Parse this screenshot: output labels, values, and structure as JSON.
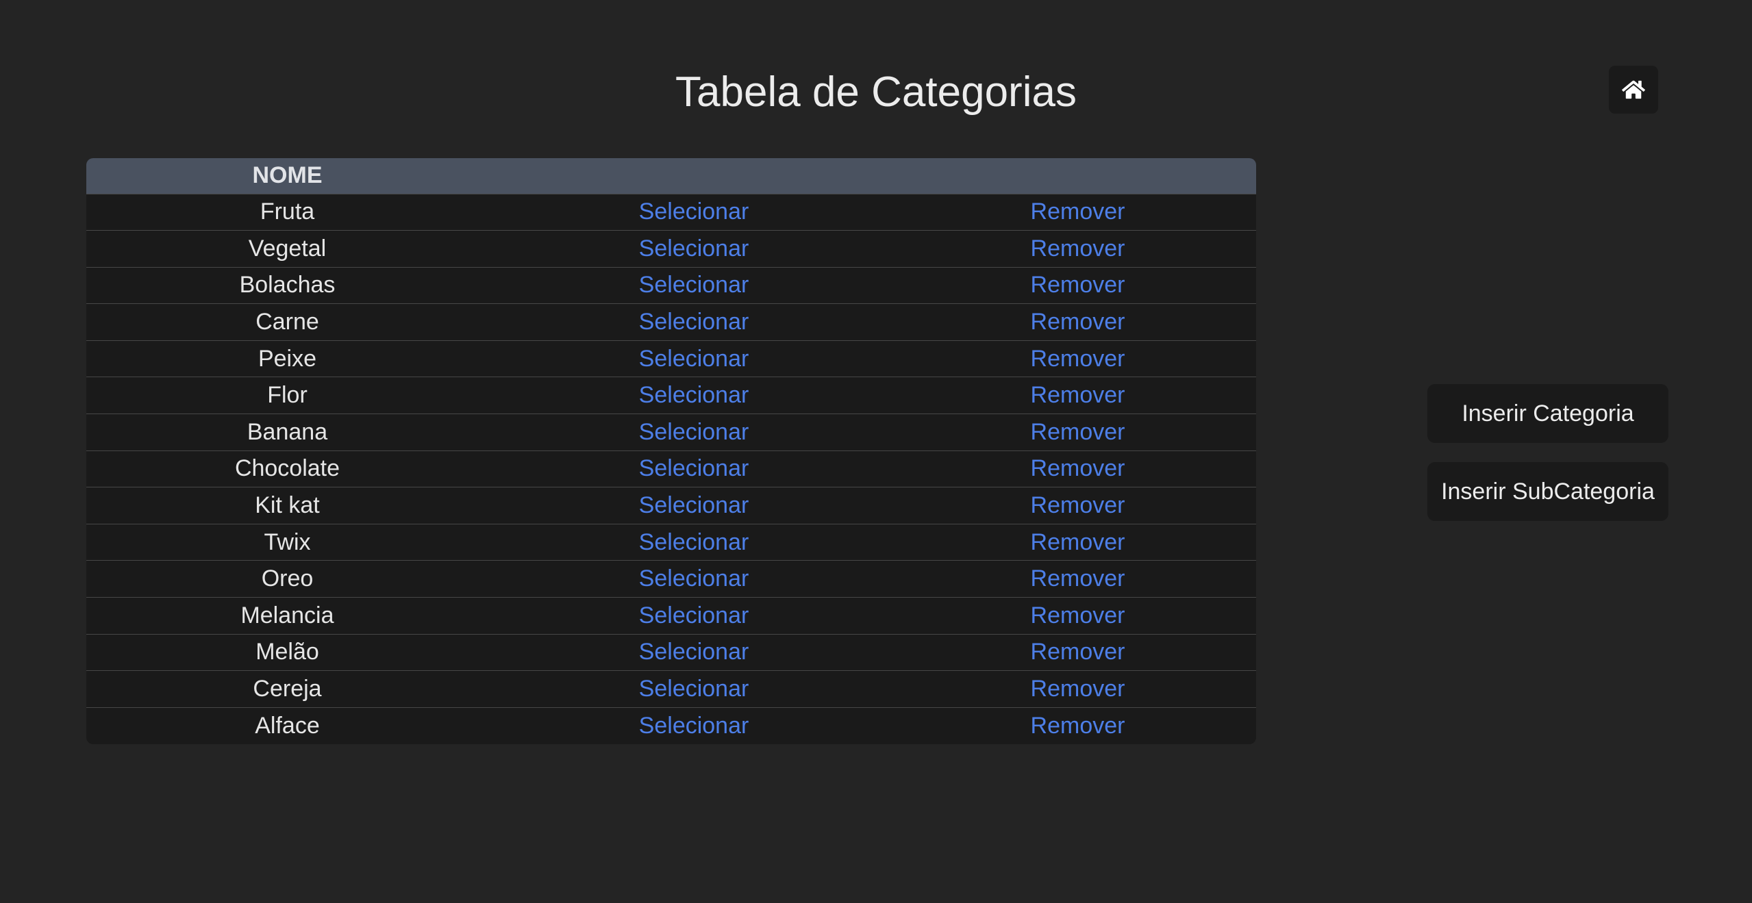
{
  "page": {
    "title": "Tabela de Categorias"
  },
  "home": {
    "icon": "home-icon"
  },
  "table": {
    "headers": [
      "NOME",
      "",
      ""
    ],
    "select_label": "Selecionar",
    "remove_label": "Remover",
    "rows": [
      {
        "name": "Fruta",
        "select": "Selecionar",
        "remove": "Remover"
      },
      {
        "name": "Vegetal",
        "select": "Selecionar",
        "remove": "Remover"
      },
      {
        "name": "Bolachas",
        "select": "Selecionar",
        "remove": "Remover"
      },
      {
        "name": "Carne",
        "select": "Selecionar",
        "remove": "Remover"
      },
      {
        "name": "Peixe",
        "select": "Selecionar",
        "remove": "Remover"
      },
      {
        "name": "Flor",
        "select": "Selecionar",
        "remove": "Remover"
      },
      {
        "name": "Banana",
        "select": "Selecionar",
        "remove": "Remover"
      },
      {
        "name": "Chocolate",
        "select": "Selecionar",
        "remove": "Remover"
      },
      {
        "name": "Kit kat",
        "select": "Selecionar",
        "remove": "Remover"
      },
      {
        "name": "Twix",
        "select": "Selecionar",
        "remove": "Remover"
      },
      {
        "name": "Oreo",
        "select": "Selecionar",
        "remove": "Remover"
      },
      {
        "name": "Melancia",
        "select": "Selecionar",
        "remove": "Remover"
      },
      {
        "name": "Melão",
        "select": "Selecionar",
        "remove": "Remover"
      },
      {
        "name": "Cereja",
        "select": "Selecionar",
        "remove": "Remover"
      },
      {
        "name": "Alface",
        "select": "Selecionar",
        "remove": "Remover"
      }
    ]
  },
  "actions": {
    "insert_category": "Inserir Categoria",
    "insert_subcategory": "Inserir SubCategoria"
  },
  "colors": {
    "background": "#242424",
    "table_header": "#4a5260",
    "table_body": "#1a1a1a",
    "link": "#4d7fe8"
  }
}
